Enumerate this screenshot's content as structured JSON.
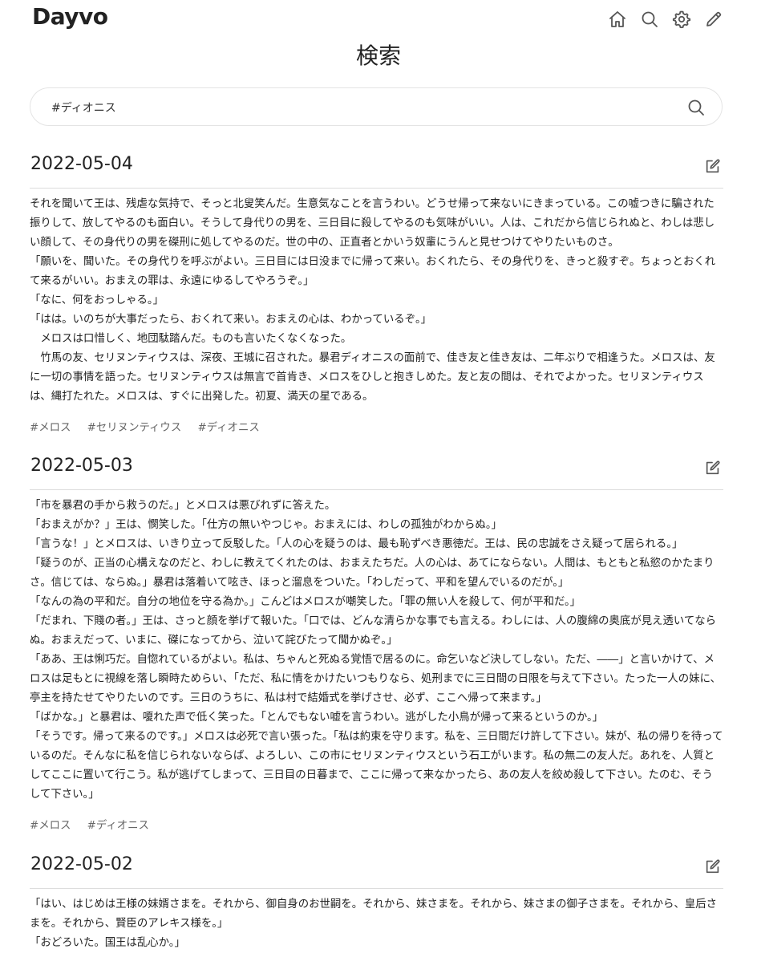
{
  "header": {
    "logo": "Dayvo",
    "icons": [
      "home-icon",
      "search-icon",
      "gear-icon",
      "pencil-icon"
    ]
  },
  "page_title": "検索",
  "search": {
    "value": "#ディオニス",
    "icon": "search-icon"
  },
  "entries": [
    {
      "date": "2022-05-04",
      "paragraphs": [
        "それを聞いて王は、残虐な気持で、そっと北叟笑んだ。生意気なことを言うわい。どうせ帰って来ないにきまっている。この嘘つきに騙された振りして、放してやるのも面白い。そうして身代りの男を、三日目に殺してやるのも気味がいい。人は、これだから信じられぬと、わしは悲しい顔して、その身代りの男を磔刑に処してやるのだ。世の中の、正直者とかいう奴輩にうんと見せつけてやりたいものさ。",
        "「願いを、聞いた。その身代りを呼ぶがよい。三日目には日没までに帰って来い。おくれたら、その身代りを、きっと殺すぞ。ちょっとおくれて来るがいい。おまえの罪は、永遠にゆるしてやろうぞ。」",
        "「なに、何をおっしゃる。」",
        "「はは。いのちが大事だったら、おくれて来い。おまえの心は、わかっているぞ。」",
        "　メロスは口惜しく、地団駄踏んだ。ものも言いたくなくなった。",
        "　竹馬の友、セリヌンティウスは、深夜、王城に召された。暴君ディオニスの面前で、佳き友と佳き友は、二年ぶりで相逢うた。メロスは、友に一切の事情を語った。セリヌンティウスは無言で首肯き、メロスをひしと抱きしめた。友と友の間は、それでよかった。セリヌンティウスは、縄打たれた。メロスは、すぐに出発した。初夏、満天の星である。"
      ],
      "tags": [
        "#メロス",
        "#セリヌンティウス",
        "#ディオニス"
      ]
    },
    {
      "date": "2022-05-03",
      "paragraphs": [
        "「市を暴君の手から救うのだ。」とメロスは悪びれずに答えた。",
        "「おまえがか？」王は、憫笑した。「仕方の無いやつじゃ。おまえには、わしの孤独がわからぬ。」",
        "「言うな！」とメロスは、いきり立って反駁した。「人の心を疑うのは、最も恥ずべき悪徳だ。王は、民の忠誠をさえ疑って居られる。」",
        "「疑うのが、正当の心構えなのだと、わしに教えてくれたのは、おまえたちだ。人の心は、あてにならない。人間は、もともと私慾のかたまりさ。信じては、ならぬ。」暴君は落着いて呟き、ほっと溜息をついた。「わしだって、平和を望んでいるのだが。」",
        "「なんの為の平和だ。自分の地位を守る為か。」こんどはメロスが嘲笑した。「罪の無い人を殺して、何が平和だ。」",
        "「だまれ、下賤の者。」王は、さっと顔を挙げて報いた。「口では、どんな清らかな事でも言える。わしには、人の腹綿の奥底が見え透いてならぬ。おまえだって、いまに、磔になってから、泣いて詫びたって聞かぬぞ。」",
        "「ああ、王は悧巧だ。自惚れているがよい。私は、ちゃんと死ぬる覚悟で居るのに。命乞いなど決してしない。ただ、――」と言いかけて、メロスは足もとに視線を落し瞬時ためらい、「ただ、私に情をかけたいつもりなら、処刑までに三日間の日限を与えて下さい。たった一人の妹に、亭主を持たせてやりたいのです。三日のうちに、私は村で結婚式を挙げさせ、必ず、ここへ帰って来ます。」",
        "「ばかな。」と暴君は、嗄れた声で低く笑った。「とんでもない嘘を言うわい。逃がした小鳥が帰って来るというのか。」",
        "「そうです。帰って来るのです。」メロスは必死で言い張った。「私は約束を守ります。私を、三日間だけ許して下さい。妹が、私の帰りを待っているのだ。そんなに私を信じられないならば、よろしい、この市にセリヌンティウスという石工がいます。私の無二の友人だ。あれを、人質としてここに置いて行こう。私が逃げてしまって、三日目の日暮まで、ここに帰って来なかったら、あの友人を絞め殺して下さい。たのむ、そうして下さい。」"
      ],
      "tags": [
        "#メロス",
        "#ディオニス"
      ]
    },
    {
      "date": "2022-05-02",
      "paragraphs": [
        "「はい、はじめは王様の妹婿さまを。それから、御自身のお世嗣を。それから、妹さまを。それから、妹さまの御子さまを。それから、皇后さまを。それから、賢臣のアレキス様を。」",
        "「おどろいた。国王は乱心か。」"
      ],
      "tags": []
    }
  ]
}
